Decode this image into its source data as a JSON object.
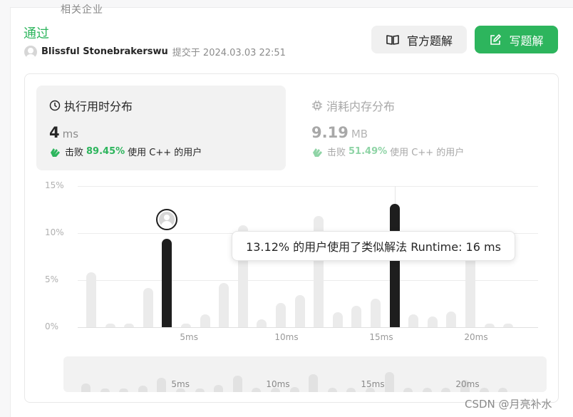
{
  "header": {
    "cut_title": "相关企业",
    "status": "通过",
    "username": "Blissful Stonebrakerswu",
    "submitted_text": "提交于 2024.03.03 22:51"
  },
  "buttons": {
    "official_solution": "官方题解",
    "write_solution": "写题解"
  },
  "runtime": {
    "title": "执行用时分布",
    "value": "4",
    "unit": "ms",
    "beat_prefix": "击败",
    "beat_pct": "89.45%",
    "beat_suffix": "使用 C++ 的用户"
  },
  "memory": {
    "title": "消耗内存分布",
    "value": "9.19",
    "unit": "MB",
    "beat_prefix": "击败",
    "beat_pct": "51.49%",
    "beat_suffix": "使用 C++ 的用户"
  },
  "tooltip": "13.12% 的用户使用了类似解法 Runtime: 16 ms",
  "chart_data": {
    "type": "bar",
    "ylim": [
      0,
      15
    ],
    "yticks": [
      "15%",
      "10%",
      "5%",
      "0%"
    ],
    "xticks": [
      "5ms",
      "10ms",
      "15ms",
      "20ms"
    ],
    "categories": [
      "1",
      "2",
      "3",
      "4",
      "5",
      "6",
      "7",
      "8",
      "9",
      "10",
      "11",
      "12",
      "13",
      "14",
      "15",
      "16",
      "17",
      "18",
      "19",
      "20",
      "21",
      "22",
      "23"
    ],
    "values": [
      5.8,
      0.3,
      0.3,
      4.2,
      9.4,
      0.3,
      1.4,
      4.7,
      10.8,
      0.8,
      2.6,
      3.4,
      11.8,
      1.6,
      2.3,
      3.0,
      13.12,
      1.4,
      1.1,
      1.7,
      9.8,
      0.4,
      0.3
    ],
    "highlighted": [
      5,
      17
    ],
    "your_submission_ms": 4
  },
  "mini_chart": {
    "xticks": [
      "5ms",
      "10ms",
      "15ms",
      "20ms"
    ],
    "values": [
      5.8,
      2.4,
      2.4,
      4.2,
      9.4,
      2.4,
      1.6,
      4.7,
      10.8,
      2.6,
      2.6,
      3.4,
      11.8,
      2.6,
      2.6,
      3.0,
      13.12,
      2.6,
      2.6,
      2.6,
      8.2,
      2.6,
      2.6
    ]
  },
  "colors": {
    "accent_green": "#2db55d",
    "bar_highlight": "#1e1e1e",
    "bar_default": "#ebebeb"
  },
  "watermark": "CSDN @月亮补水"
}
